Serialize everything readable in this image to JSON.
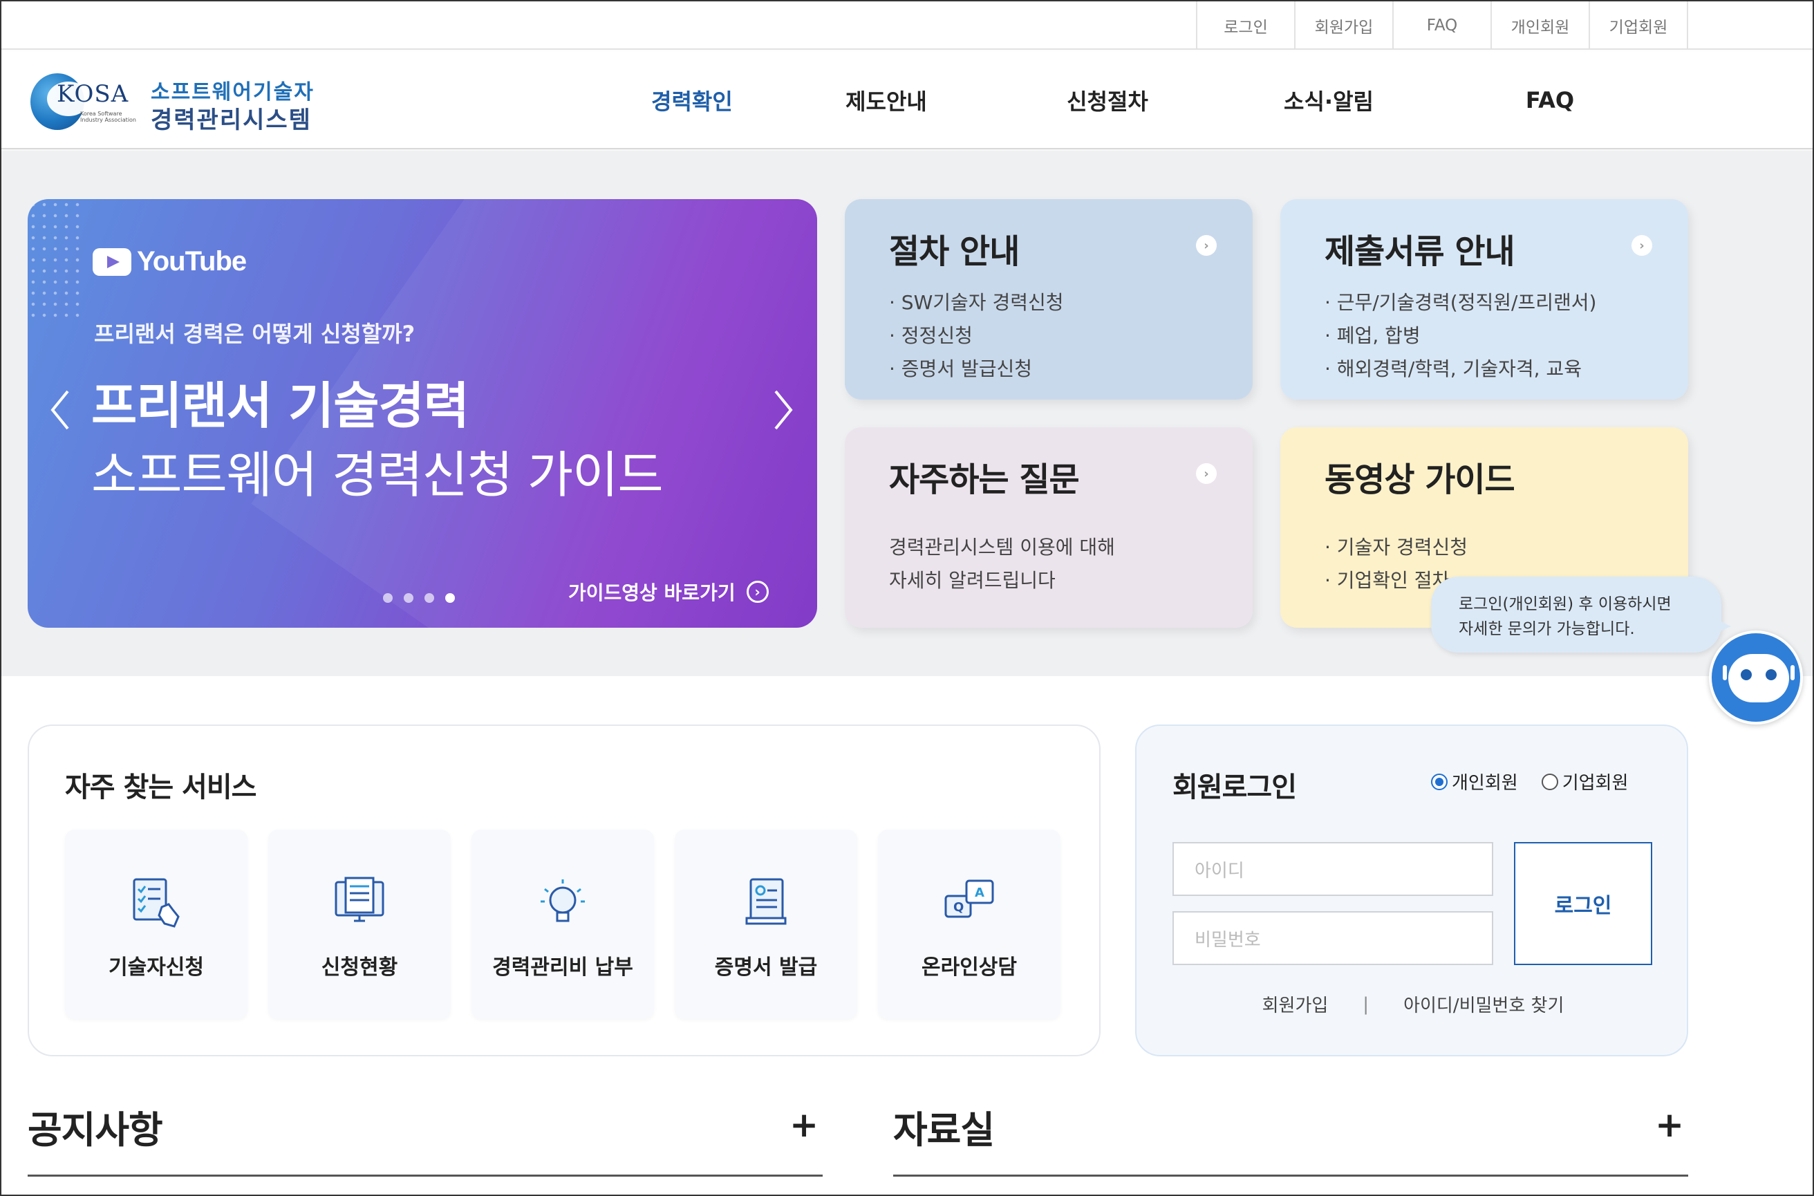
{
  "util_nav": [
    "로그인",
    "회원가입",
    "FAQ",
    "개인회원",
    "기업회원"
  ],
  "logo": {
    "brand": "KOSA",
    "brand_sub": "Korea Software Industry Association",
    "title_line1": "소프트웨어기술자",
    "title_line2": "경력관리시스템"
  },
  "gnb": [
    "경력확인",
    "제도안내",
    "신청절차",
    "소식·알림",
    "FAQ"
  ],
  "banner": {
    "youtube": "YouTube",
    "question": "프리랜서 경력은 어떻게 신청할까?",
    "headline1": "프리랜서 기술경력",
    "headline2": "소프트웨어 경력신청 가이드",
    "link": "가이드영상 바로가기",
    "slide_count": 4,
    "active_slide": 4
  },
  "cards": {
    "procedure": {
      "title": "절차 안내",
      "items": [
        "· SW기술자 경력신청",
        "· 정정신청",
        "· 증명서 발급신청"
      ]
    },
    "documents": {
      "title": "제출서류 안내",
      "items": [
        "· 근무/기술경력(정직원/프리랜서)",
        "· 폐업, 합병",
        "· 해외경력/학력, 기술자격, 교육"
      ]
    },
    "faq": {
      "title": "자주하는 질문",
      "desc1": "경력관리시스템 이용에 대해",
      "desc2": "자세히 알려드립니다"
    },
    "video": {
      "title": "동영상 가이드",
      "items": [
        "· 기술자 경력신청",
        "· 기업확인 절차"
      ]
    }
  },
  "chatbot": {
    "line1": "로그인(개인회원) 후 이용하시면",
    "line2": "자세한 문의가 가능합니다."
  },
  "services": {
    "title": "자주 찾는 서비스",
    "items": [
      "기술자신청",
      "신청현황",
      "경력관리비 납부",
      "증명서 발급",
      "온라인상담"
    ]
  },
  "login": {
    "title": "회원로그인",
    "radio_personal": "개인회원",
    "radio_company": "기업회원",
    "selected": "개인회원",
    "id_placeholder": "아이디",
    "pw_placeholder": "비밀번호",
    "button": "로그인",
    "signup": "회원가입",
    "separator": "|",
    "find": "아이디/비밀번호 찾기"
  },
  "boards": {
    "notice": "공지사항",
    "archive": "자료실",
    "more": "+"
  },
  "colors": {
    "primary": "#1e5ea8",
    "banner_start": "#5d8fe0",
    "banner_end": "#7a2fc4"
  }
}
